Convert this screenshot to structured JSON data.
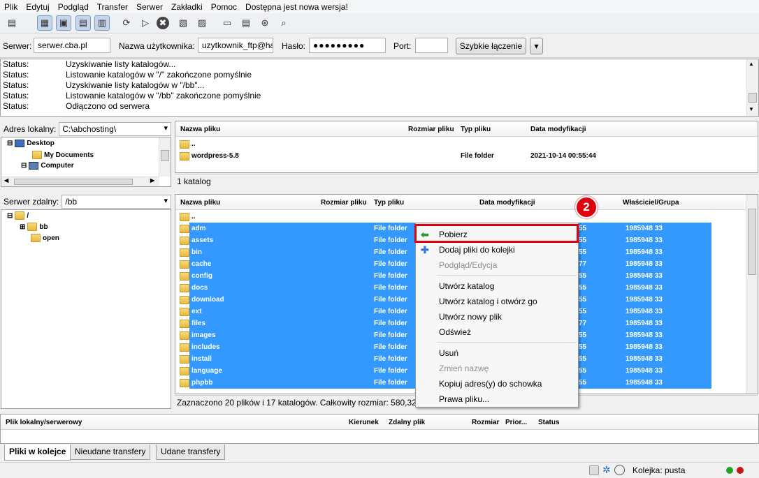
{
  "menu": [
    "Plik",
    "Edytuj",
    "Podgląd",
    "Transfer",
    "Serwer",
    "Zakładki",
    "Pomoc",
    "Dostępna jest nowa wersja!"
  ],
  "toolbar_icons": [
    "site-manager-icon",
    "message-log-icon",
    "local-tree-icon",
    "remote-tree-icon",
    "queue-icon",
    "refresh-icon",
    "process-queue-icon",
    "cancel-icon",
    "disconnect-icon",
    "reconnect-icon",
    "filter-icon",
    "compare-icon",
    "sync-browse-icon",
    "search-icon"
  ],
  "quickconnect": {
    "host_label": "Serwer:",
    "host": "serwer.cba.pl",
    "user_label": "Nazwa użytkownika:",
    "user": "uzytkownik_ftp@ha",
    "pass_label": "Hasło:",
    "pass": "●●●●●●●●●",
    "port_label": "Port:",
    "port": "",
    "button": "Szybkie łączenie"
  },
  "log": [
    {
      "k": "Status:",
      "v": "Uzyskiwanie listy katalogów..."
    },
    {
      "k": "Status:",
      "v": "Listowanie katalogów w \"/\" zakończone pomyślnie"
    },
    {
      "k": "Status:",
      "v": "Uzyskiwanie listy katalogów w \"/bb\"..."
    },
    {
      "k": "Status:",
      "v": "Listowanie katalogów w \"/bb\" zakończone pomyślnie"
    },
    {
      "k": "Status:",
      "v": "Odłączono od serwera"
    }
  ],
  "local": {
    "label": "Adres lokalny:",
    "path": "C:\\abchosting\\",
    "tree": [
      "Desktop",
      "My Documents",
      "Computer"
    ],
    "headers": [
      "Nazwa pliku",
      "Rozmiar pliku",
      "Typ pliku",
      "Data modyfikacji"
    ],
    "files": [
      {
        "name": "..",
        "type": "",
        "date": ""
      },
      {
        "name": "wordpress-5.8",
        "type": "File folder",
        "date": "2021-10-14 00:55:44"
      }
    ],
    "status": "1 katalog"
  },
  "remote": {
    "label": "Serwer zdalny:",
    "path": "/bb",
    "tree": [
      "/",
      "bb",
      "open"
    ],
    "headers": [
      "Nazwa pliku",
      "Rozmiar pliku",
      "Typ pliku",
      "Data modyfikacji",
      "",
      "Właściciel/Grupa"
    ],
    "files": [
      {
        "name": "..",
        "type": "",
        "perm": "",
        "owner": ""
      },
      {
        "name": "adm",
        "type": "File folder",
        "perm": "55",
        "owner": "1985948 33"
      },
      {
        "name": "assets",
        "type": "File folder",
        "perm": "55",
        "owner": "1985948 33"
      },
      {
        "name": "bin",
        "type": "File folder",
        "perm": "55",
        "owner": "1985948 33"
      },
      {
        "name": "cache",
        "type": "File folder",
        "perm": "77",
        "owner": "1985948 33"
      },
      {
        "name": "config",
        "type": "File folder",
        "perm": "55",
        "owner": "1985948 33"
      },
      {
        "name": "docs",
        "type": "File folder",
        "perm": "55",
        "owner": "1985948 33"
      },
      {
        "name": "download",
        "type": "File folder",
        "perm": "55",
        "owner": "1985948 33"
      },
      {
        "name": "ext",
        "type": "File folder",
        "perm": "55",
        "owner": "1985948 33"
      },
      {
        "name": "files",
        "type": "File folder",
        "perm": "77",
        "owner": "1985948 33"
      },
      {
        "name": "images",
        "type": "File folder",
        "perm": "55",
        "owner": "1985948 33"
      },
      {
        "name": "includes",
        "type": "File folder",
        "perm": "55",
        "owner": "1985948 33"
      },
      {
        "name": "install",
        "type": "File folder",
        "perm": "55",
        "owner": "1985948 33"
      },
      {
        "name": "language",
        "type": "File folder",
        "perm": "55",
        "owner": "1985948 33"
      },
      {
        "name": "phpbb",
        "type": "File folder",
        "perm": "55",
        "owner": "1985948 33"
      }
    ],
    "status": "Zaznaczono 20 plików i 17 katalogów. Całkowity rozmiar: 580,326"
  },
  "context_menu": [
    {
      "label": "Pobierz",
      "icon": "download-arrow-icon",
      "disabled": false
    },
    {
      "label": "Dodaj pliki do kolejki",
      "icon": "add-queue-icon",
      "disabled": false
    },
    {
      "label": "Podgląd/Edycja",
      "disabled": true
    },
    {
      "sep": true
    },
    {
      "label": "Utwórz katalog",
      "disabled": false
    },
    {
      "label": "Utwórz katalog i otwórz go",
      "disabled": false
    },
    {
      "label": "Utwórz nowy plik",
      "disabled": false
    },
    {
      "label": "Odśwież",
      "disabled": false
    },
    {
      "sep": true
    },
    {
      "label": "Usuń",
      "disabled": false
    },
    {
      "label": "Zmień nazwę",
      "disabled": true
    },
    {
      "label": "Kopiuj adres(y) do schowka",
      "disabled": false
    },
    {
      "label": "Prawa pliku...",
      "disabled": false
    }
  ],
  "badge": "2",
  "queue": {
    "headers": [
      "Plik lokalny/serwerowy",
      "Kierunek",
      "Zdalny plik",
      "Rozmiar",
      "Prior...",
      "Status"
    ]
  },
  "tabs": [
    "Pliki w kolejce",
    "Nieudane transfery",
    "Udane transfery"
  ],
  "statusbar": {
    "queue": "Kolejka: pusta"
  },
  "colors": {
    "selection": "#3399ff",
    "highlight": "#e0000f"
  }
}
